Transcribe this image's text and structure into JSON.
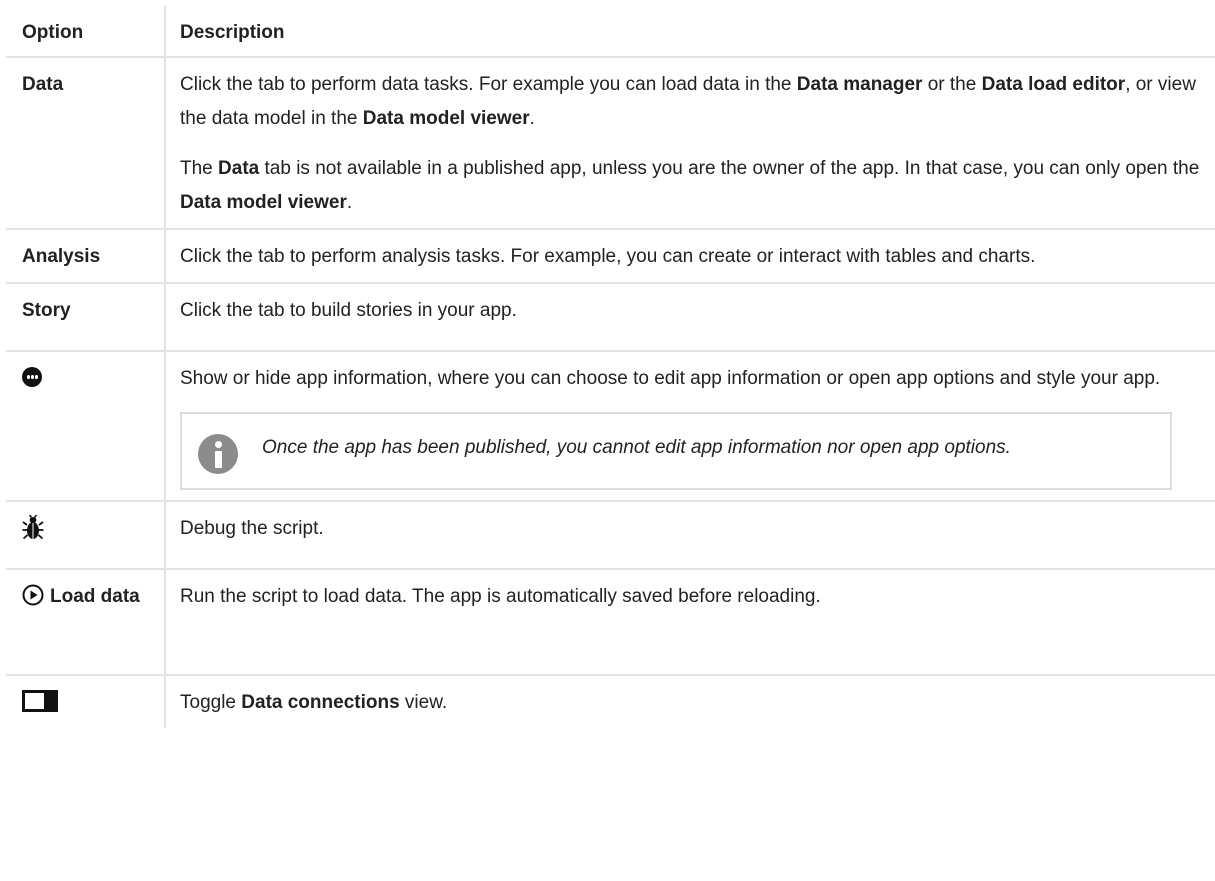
{
  "table": {
    "headers": {
      "option": "Option",
      "description": "Description"
    },
    "rows": {
      "data": {
        "option": "Data",
        "p1": {
          "t1": "Click the tab to perform data tasks. For example you can load data in the ",
          "b1": "Data manager",
          "t2": " or the ",
          "b2": "Data load editor",
          "t3": ", or view the data model in the ",
          "b3": "Data model viewer",
          "t4": "."
        },
        "p2": {
          "t1": "The ",
          "b1": "Data",
          "t2": " tab is not available in a published app, unless you are the owner of the app. In that case, you can only open the ",
          "b2": "Data model viewer",
          "t3": "."
        }
      },
      "analysis": {
        "option": "Analysis",
        "description": "Click the tab to perform analysis tasks. For example, you can create or interact with tables and charts."
      },
      "story": {
        "option": "Story",
        "description": "Click the tab to build stories in your app."
      },
      "app_info": {
        "option_icon": "ellipsis-circle-icon",
        "description": "Show or hide app information, where you can choose to edit app information or open app options and style your app.",
        "note_icon": "info-icon",
        "note": "Once the app has been published, you cannot edit app information nor open app options."
      },
      "debug": {
        "option_icon": "bug-icon",
        "description": "Debug the script."
      },
      "load": {
        "option_icon": "play-circle-icon",
        "option": "Load data",
        "description": "Run the script to load data. The app is automatically saved before reloading."
      },
      "toggle": {
        "option_icon": "panel-toggle-icon",
        "t1": "Toggle ",
        "b1": "Data connections",
        "t2": " view."
      }
    }
  }
}
